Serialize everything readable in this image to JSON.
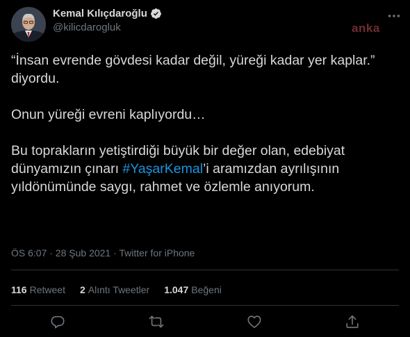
{
  "author": {
    "name": "Kemal Kılıçdaroğlu",
    "handle": "@kilicdarogluk"
  },
  "watermark": "anka",
  "tweet": {
    "line1_p1": "“İnsan evrende gövdesi kadar değil, yüreği kadar yer kaplar.” diyordu.",
    "line2": "Onun yüreği evreni kaplıyordu…",
    "p3_before": "Bu toprakların yetiştirdiği büyük bir değer olan, edebiyat dünyamızın çınarı ",
    "p3_hashtag": "#YaşarKemal",
    "p3_after": "’i aramızdan ayrılışının yıldönümünde saygı, rahmet ve özlemle anıyorum."
  },
  "meta": "ÖS 6:07 · 28 Şub 2021 · Twitter for iPhone",
  "stats": [
    {
      "count": "116",
      "label": "Retweet"
    },
    {
      "count": "2",
      "label": "Alıntı Tweetler"
    },
    {
      "count": "1.047",
      "label": "Beğeni"
    }
  ],
  "icons": {
    "reply": "reply-icon",
    "retweet": "retweet-icon",
    "like": "heart-icon",
    "share": "share-icon"
  },
  "colors": {
    "background": "#000000",
    "text": "#d9d9d9",
    "secondary": "#6e767d",
    "hashtag": "#1b95e0",
    "verified": "#d9d9d9"
  }
}
